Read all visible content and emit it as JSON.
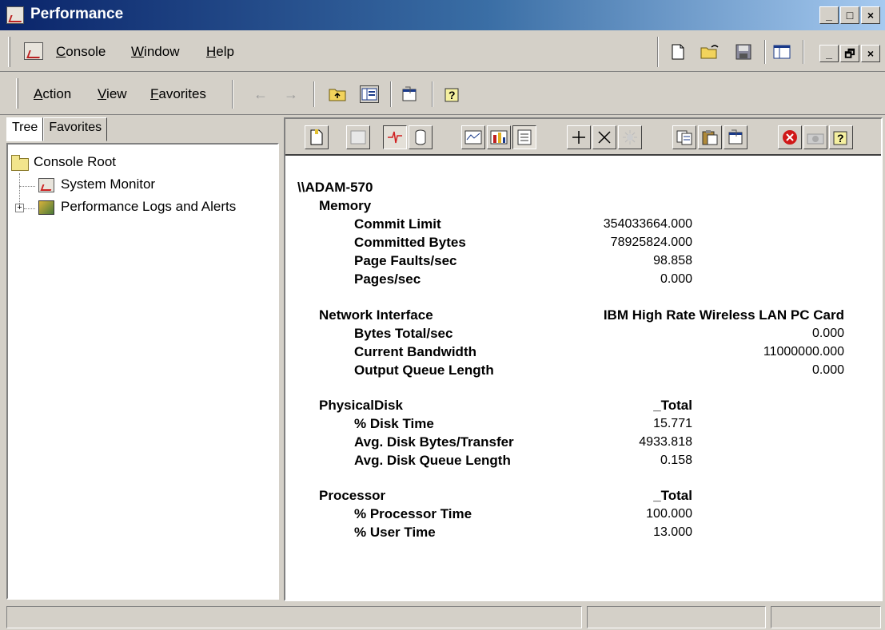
{
  "window": {
    "title": "Performance",
    "buttons": [
      "_",
      "□",
      "×"
    ]
  },
  "menubar": {
    "items": [
      {
        "label": "Console",
        "accel": "C",
        "rest": "onsole"
      },
      {
        "label": "Window",
        "accel": "W",
        "rest": "indow"
      },
      {
        "label": "Help",
        "accel": "H",
        "rest": "elp"
      }
    ],
    "mdi_buttons": [
      "_",
      "🗗",
      "×"
    ]
  },
  "actionbar": {
    "items": [
      {
        "label": "Action",
        "accel": "A",
        "rest": "ction"
      },
      {
        "label": "View",
        "accel": "V",
        "rest": "iew"
      },
      {
        "label": "Favorites",
        "accel": "F",
        "rest": "avorites"
      }
    ]
  },
  "left_tabs": [
    "Tree",
    "Favorites"
  ],
  "tree": {
    "root": "Console Root",
    "children": [
      "System Monitor",
      "Performance Logs and Alerts"
    ]
  },
  "report": {
    "computer": "\\\\ADAM-570",
    "sections": [
      {
        "object": "Memory",
        "instance": "",
        "counters": [
          {
            "name": "Commit Limit",
            "value": "354033664.000"
          },
          {
            "name": "Committed Bytes",
            "value": "78925824.000"
          },
          {
            "name": "Page Faults/sec",
            "value": "98.858"
          },
          {
            "name": "Pages/sec",
            "value": "0.000"
          }
        ]
      },
      {
        "object": "Network Interface",
        "instance": "IBM High Rate Wireless LAN PC Card",
        "counters": [
          {
            "name": "Bytes Total/sec",
            "value": "0.000"
          },
          {
            "name": "Current Bandwidth",
            "value": "11000000.000"
          },
          {
            "name": "Output Queue Length",
            "value": "0.000"
          }
        ]
      },
      {
        "object": "PhysicalDisk",
        "instance": "_Total",
        "counters": [
          {
            "name": "% Disk Time",
            "value": "15.771"
          },
          {
            "name": "Avg. Disk Bytes/Transfer",
            "value": "4933.818"
          },
          {
            "name": "Avg. Disk Queue Length",
            "value": "0.158"
          }
        ]
      },
      {
        "object": "Processor",
        "instance": "_Total",
        "counters": [
          {
            "name": "% Processor Time",
            "value": "100.000"
          },
          {
            "name": "% User Time",
            "value": "13.000"
          }
        ]
      }
    ]
  },
  "colors": {
    "titlebar_start": "#0a246a",
    "titlebar_end": "#a6caf0",
    "face": "#d4d0c8"
  }
}
